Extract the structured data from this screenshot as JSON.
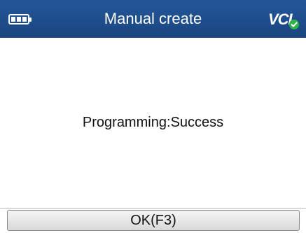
{
  "header": {
    "title": "Manual create",
    "battery_icon": "battery-icon",
    "logo_text": "VCI",
    "logo_icon": "vci-connected-icon",
    "colors": {
      "bar": "#1f4e8c",
      "check": "#2db34a"
    }
  },
  "main": {
    "message": "Programming:Success"
  },
  "footer": {
    "ok_label": "OK(F3)"
  }
}
